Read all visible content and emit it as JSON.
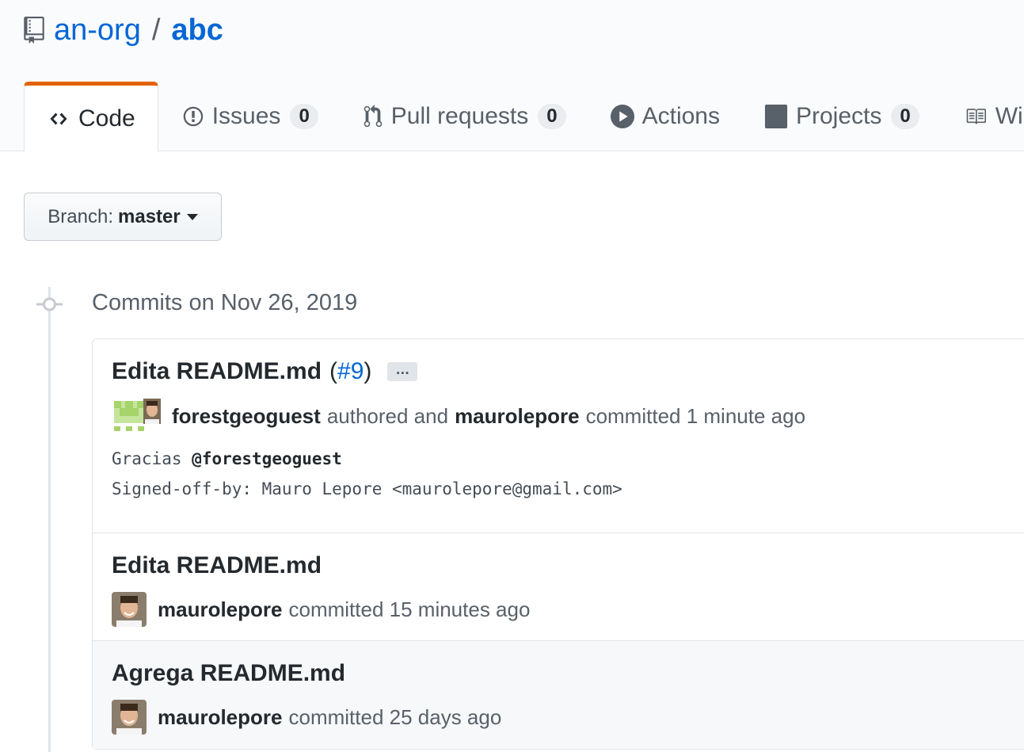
{
  "repo": {
    "owner": "an-org",
    "separator": "/",
    "name": "abc"
  },
  "tabs": [
    {
      "label": "Code",
      "selected": true
    },
    {
      "label": "Issues",
      "count": "0"
    },
    {
      "label": "Pull requests",
      "count": "0"
    },
    {
      "label": "Actions"
    },
    {
      "label": "Projects",
      "count": "0"
    },
    {
      "label": "Wiki"
    }
  ],
  "branch": {
    "label": "Branch:",
    "value": "master"
  },
  "commits_group": {
    "title": "Commits on Nov 26, 2019"
  },
  "commits": [
    {
      "message": "Edita README.md",
      "pr_open": "(",
      "pr": "#9",
      "pr_close": ")",
      "ellipsis": "…",
      "author": "forestgeoguest",
      "authored_text": "authored and",
      "committer": "maurolepore",
      "committed_text": "committed 1 minute ago",
      "description_prefix": "Gracias",
      "description_mention": "@forestgeoguest",
      "signed_off": "Signed-off-by: Mauro Lepore <maurolepore@gmail.com>"
    },
    {
      "message": "Edita README.md",
      "committer": "maurolepore",
      "committed_text": "committed 15 minutes ago"
    },
    {
      "message": "Agrega README.md",
      "committer": "maurolepore",
      "committed_text": "committed 25 days ago"
    }
  ],
  "colors": {
    "link": "#0366d6",
    "tab_accent": "#e36209",
    "muted": "#586069"
  }
}
